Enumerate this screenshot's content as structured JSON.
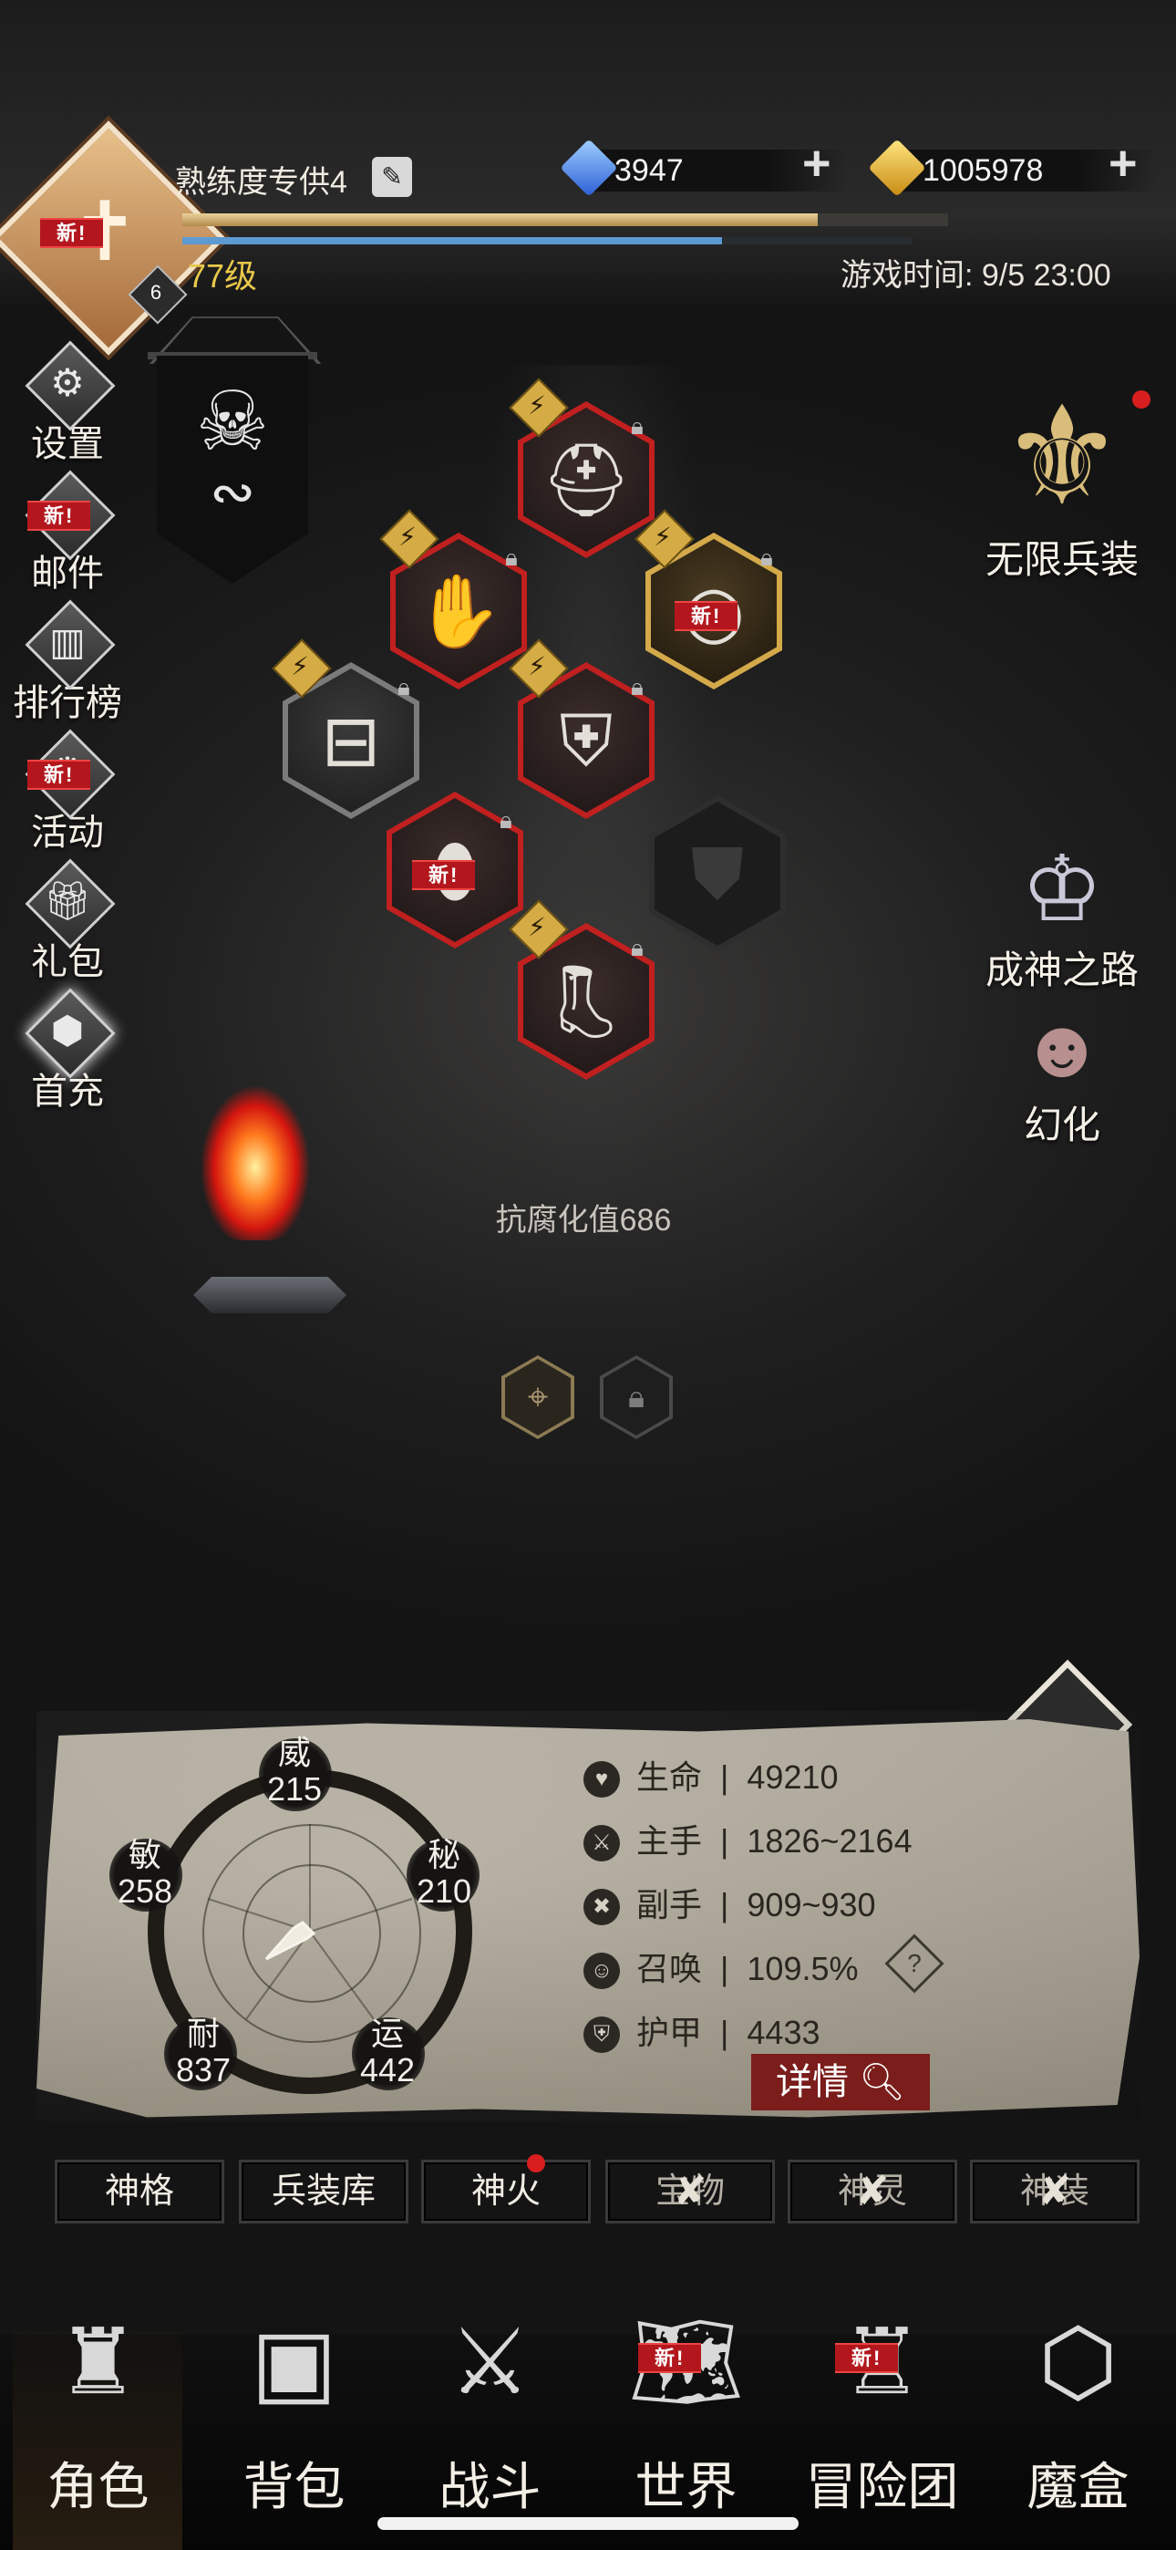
{
  "player": {
    "name": "熟练度专供4",
    "level_label": "77级",
    "rank_badge": "6",
    "new_badge": "新!",
    "exp_progress": 0.83,
    "secondary_progress": 0.74
  },
  "currencies": {
    "gems": "3947",
    "gold": "1005978"
  },
  "game_time": "游戏时间: 9/5 23:00",
  "left_menu": [
    {
      "label": "设置",
      "icon": "gear-icon"
    },
    {
      "label": "邮件",
      "icon": "mail-icon",
      "badge": "新!"
    },
    {
      "label": "排行榜",
      "icon": "ranking-icon"
    },
    {
      "label": "活动",
      "icon": "event-icon",
      "badge": "新!"
    },
    {
      "label": "礼包",
      "icon": "gift-icon"
    },
    {
      "label": "首充",
      "icon": "first-charge-icon"
    }
  ],
  "right_menu": {
    "infinite_gear": "无限兵装",
    "path_to_godhood": "成神之路",
    "transform": "幻化"
  },
  "equipment": {
    "corruption_resistance": "抗腐化值686",
    "new_badge": "新!"
  },
  "attributes": {
    "wei": {
      "label": "威",
      "value": "215"
    },
    "mi": {
      "label": "秘",
      "value": "210"
    },
    "yun": {
      "label": "运",
      "value": "442"
    },
    "nai": {
      "label": "耐",
      "value": "837"
    },
    "min": {
      "label": "敏",
      "value": "258"
    }
  },
  "stats": [
    {
      "label": "生命",
      "value": "49210",
      "icon": "heart-icon"
    },
    {
      "label": "主手",
      "value": "1826~2164",
      "icon": "main-hand-icon"
    },
    {
      "label": "副手",
      "value": "909~930",
      "icon": "off-hand-icon"
    },
    {
      "label": "召唤",
      "value": "109.5%",
      "icon": "summon-icon"
    },
    {
      "label": "护甲",
      "value": "4433",
      "icon": "armor-icon"
    }
  ],
  "stat_separator": "|",
  "help_label": "?",
  "detail_button": "详情",
  "sub_tabs": [
    {
      "label": "神格",
      "locked": false
    },
    {
      "label": "兵装库",
      "locked": false
    },
    {
      "label": "神火",
      "locked": false,
      "dot": true
    },
    {
      "label": "宝物",
      "locked": true
    },
    {
      "label": "神灵",
      "locked": true
    },
    {
      "label": "神装",
      "locked": true
    }
  ],
  "bottom_nav": [
    {
      "label": "角色",
      "icon": "helmet-icon",
      "active": true
    },
    {
      "label": "背包",
      "icon": "backpack-icon"
    },
    {
      "label": "战斗",
      "icon": "shield-swords-icon"
    },
    {
      "label": "世界",
      "icon": "map-scroll-icon",
      "badge": "新!"
    },
    {
      "label": "冒险团",
      "icon": "castle-icon",
      "badge": "新!"
    },
    {
      "label": "魔盒",
      "icon": "cube-icon"
    }
  ],
  "colors": {
    "gold_bar": "#d9bf82",
    "blue_bar": "#5d9ad1",
    "accent_red": "#b3171d",
    "level_yellow": "#e8c84b"
  }
}
